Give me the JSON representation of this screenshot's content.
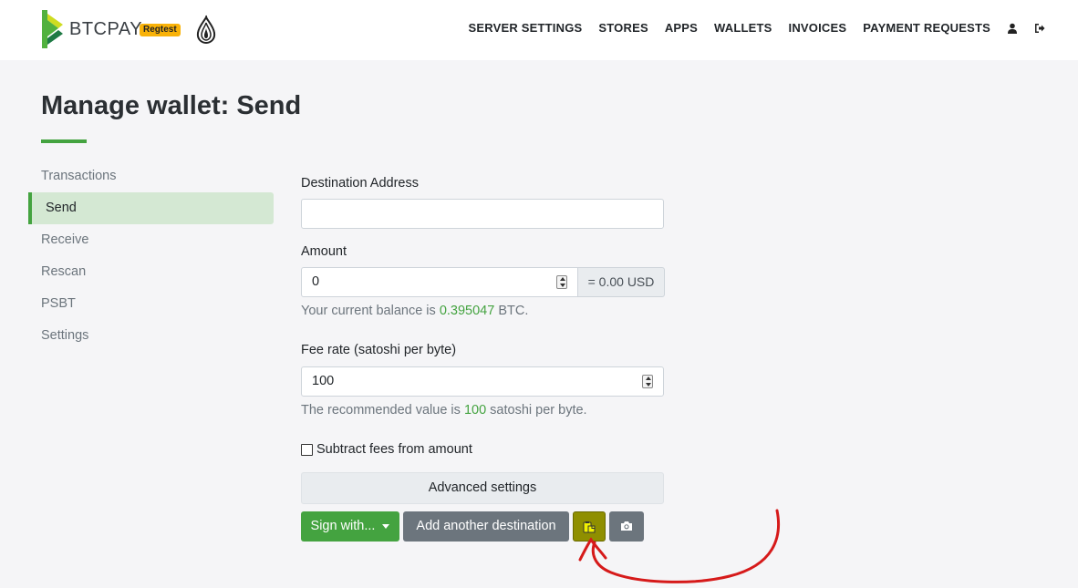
{
  "navbar": {
    "brand": "BTCPAY",
    "badge": "Regtest",
    "links": [
      "SERVER SETTINGS",
      "STORES",
      "APPS",
      "WALLETS",
      "INVOICES",
      "PAYMENT REQUESTS"
    ],
    "icons": [
      "user-icon",
      "logout-icon"
    ]
  },
  "page": {
    "title": "Manage wallet: Send"
  },
  "sidebar": {
    "items": [
      {
        "label": "Transactions"
      },
      {
        "label": "Send"
      },
      {
        "label": "Receive"
      },
      {
        "label": "Rescan"
      },
      {
        "label": "PSBT"
      },
      {
        "label": "Settings"
      }
    ],
    "active": "Send"
  },
  "form": {
    "destination_label": "Destination Address",
    "destination_value": "",
    "amount_label": "Amount",
    "amount_value": "0",
    "amount_fiat": "= 0.00 USD",
    "balance_prefix": "Your current balance is",
    "balance_value": "0.395047",
    "balance_suffix": "BTC.",
    "fee_label": "Fee rate (satoshi per byte)",
    "fee_value": "100",
    "fee_help_prefix": "The recommended value is",
    "fee_help_value": "100",
    "fee_help_suffix": "satoshi per byte.",
    "subtract_fees_label": "Subtract fees from amount",
    "subtract_fees_checked": false,
    "advanced_label": "Advanced settings"
  },
  "actions": {
    "sign_label": "Sign with...",
    "add_destination_label": "Add another destination",
    "paste_icon": "clipboard-paste-icon",
    "camera_icon": "camera-icon"
  },
  "colors": {
    "accent": "#44a340",
    "highlight": "#8f8f00",
    "annotation": "#d61a1a"
  }
}
